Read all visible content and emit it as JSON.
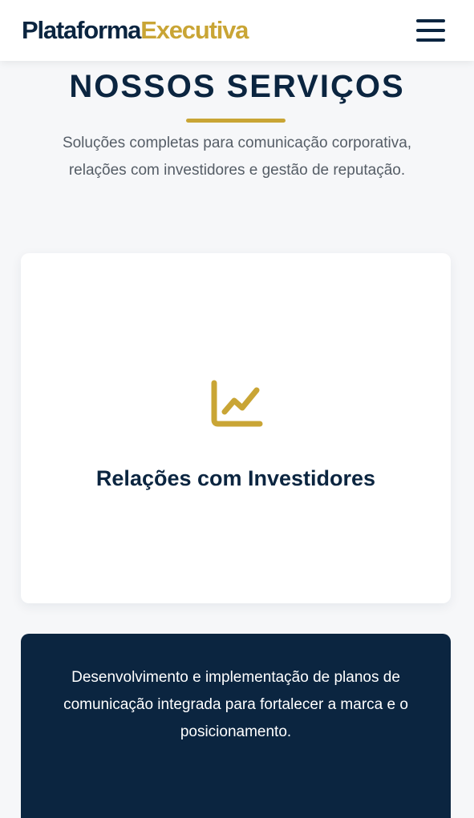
{
  "header": {
    "logo_part1": "Plataforma",
    "logo_part2": "Executiva",
    "menu_icon": "hamburger-menu-icon"
  },
  "section": {
    "title": "NOSSOS SERVIÇOS",
    "subtitle": "Soluções completas para comunicação corporativa, relações com investidores e gestão de reputação."
  },
  "services": [
    {
      "icon": "chart-line-icon",
      "title": "Relações com Investidores"
    },
    {
      "description": "Desenvolvimento e implementação de planos de comunicação integrada para fortalecer a marca e o posicionamento."
    }
  ],
  "colors": {
    "navy": "#0b2540",
    "gold": "#c9a535",
    "background": "#f6f7f9"
  }
}
